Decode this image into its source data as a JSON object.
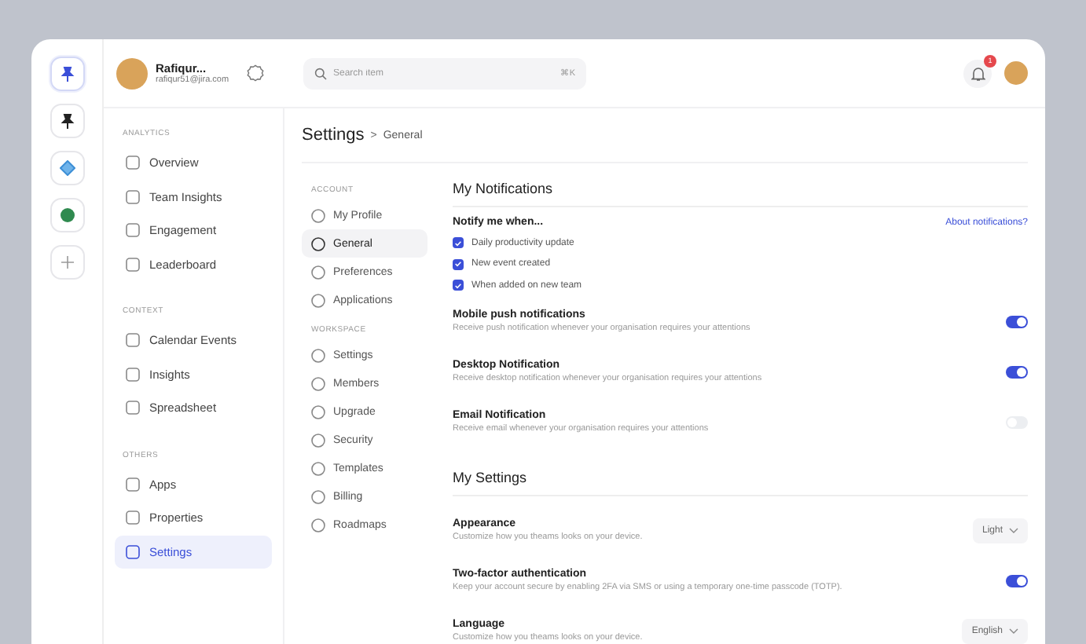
{
  "user": {
    "name": "Rafiqur...",
    "email": "rafiqur51@jira.com"
  },
  "search": {
    "placeholder": "Search item",
    "shortcut": "⌘K"
  },
  "notifications_badge": "1",
  "sidebar": {
    "sections": [
      {
        "title": "ANALYTICS",
        "items": [
          {
            "label": "Overview",
            "selected": false
          },
          {
            "label": "Team Insights",
            "selected": false
          },
          {
            "label": "Engagement",
            "selected": false
          },
          {
            "label": "Leaderboard",
            "selected": false
          }
        ]
      },
      {
        "title": "CONTEXT",
        "items": [
          {
            "label": "Calendar Events",
            "selected": false
          },
          {
            "label": "Insights",
            "selected": false
          },
          {
            "label": "Spreadsheet",
            "selected": false
          }
        ]
      },
      {
        "title": "OTHERS",
        "items": [
          {
            "label": "Apps",
            "selected": false
          },
          {
            "label": "Properties",
            "selected": false
          },
          {
            "label": "Settings",
            "selected": true
          }
        ]
      }
    ]
  },
  "breadcrumb": {
    "title": "Settings",
    "separator": ">",
    "current": "General"
  },
  "subnav": {
    "sections": [
      {
        "title": "ACCOUNT",
        "items": [
          {
            "label": "My Profile",
            "selected": false
          },
          {
            "label": "General",
            "selected": true
          },
          {
            "label": "Preferences",
            "selected": false
          },
          {
            "label": "Applications",
            "selected": false
          }
        ]
      },
      {
        "title": "WORKSPACE",
        "items": [
          {
            "label": "Settings",
            "selected": false
          },
          {
            "label": "Members",
            "selected": false
          },
          {
            "label": "Upgrade",
            "selected": false
          },
          {
            "label": "Security",
            "selected": false
          },
          {
            "label": "Templates",
            "selected": false
          },
          {
            "label": "Billing",
            "selected": false
          },
          {
            "label": "Roadmaps",
            "selected": false
          }
        ]
      }
    ]
  },
  "notifications": {
    "title": "My Notifications",
    "notify_label": "Notify me when...",
    "help_link": "About notifications?",
    "checks": [
      {
        "label": "Daily productivity update",
        "checked": true
      },
      {
        "label": "New event created",
        "checked": true
      },
      {
        "label": "When added on new team",
        "checked": true
      }
    ],
    "rows": [
      {
        "title": "Mobile push notifications",
        "description": "Receive push notification whenever your organisation requires your attentions",
        "on": true
      },
      {
        "title": "Desktop Notification",
        "description": "Receive desktop notification whenever your organisation requires your attentions",
        "on": true
      },
      {
        "title": "Email Notification",
        "description": "Receive email  whenever your organisation requires your attentions",
        "on": false
      }
    ]
  },
  "my_settings": {
    "title": "My Settings",
    "rows": [
      {
        "kind": "select",
        "title": "Appearance",
        "description": "Customize how you theams looks on your device.",
        "value": "Light"
      },
      {
        "kind": "toggle",
        "title": "Two-factor authentication",
        "description": "Keep your account secure by enabling 2FA via SMS or using a temporary one-time passcode (TOTP).",
        "on": true
      },
      {
        "kind": "select",
        "title": "Language",
        "description": "Customize how you theams looks on your device.",
        "value": "English"
      }
    ]
  }
}
